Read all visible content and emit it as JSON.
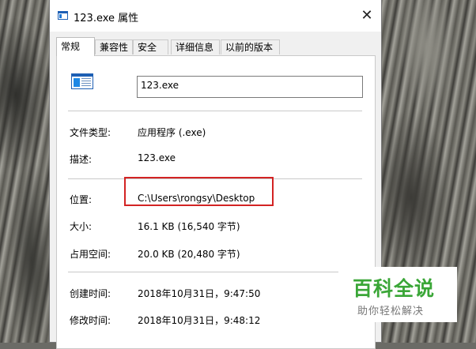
{
  "window": {
    "title": "123.exe 属性",
    "close_glyph": "✕"
  },
  "tabs": [
    {
      "label": "常规",
      "active": true
    },
    {
      "label": "兼容性",
      "active": false
    },
    {
      "label": "安全",
      "active": false
    },
    {
      "label": "详细信息",
      "active": false
    },
    {
      "label": "以前的版本",
      "active": false
    }
  ],
  "general": {
    "file_name": "123.exe",
    "file_type_label": "文件类型:",
    "file_type_value": "应用程序 (.exe)",
    "description_label": "描述:",
    "description_value": "123.exe",
    "location_label": "位置:",
    "location_value": "C:\\Users\\rongsy\\Desktop",
    "size_label": "大小:",
    "size_value": "16.1 KB (16,540 字节)",
    "size_on_disk_label": "占用空间:",
    "size_on_disk_value": "20.0 KB (20,480 字节)",
    "created_label": "创建时间:",
    "created_value": "2018年10月31日，9:47:50",
    "modified_label": "修改时间:",
    "modified_value": "2018年10月31日，9:48:12"
  },
  "watermark": {
    "title": "百科全说",
    "subtitle": "助你轻松解决"
  },
  "colors": {
    "highlight_border": "#d32323",
    "watermark_green": "#3aa637"
  }
}
